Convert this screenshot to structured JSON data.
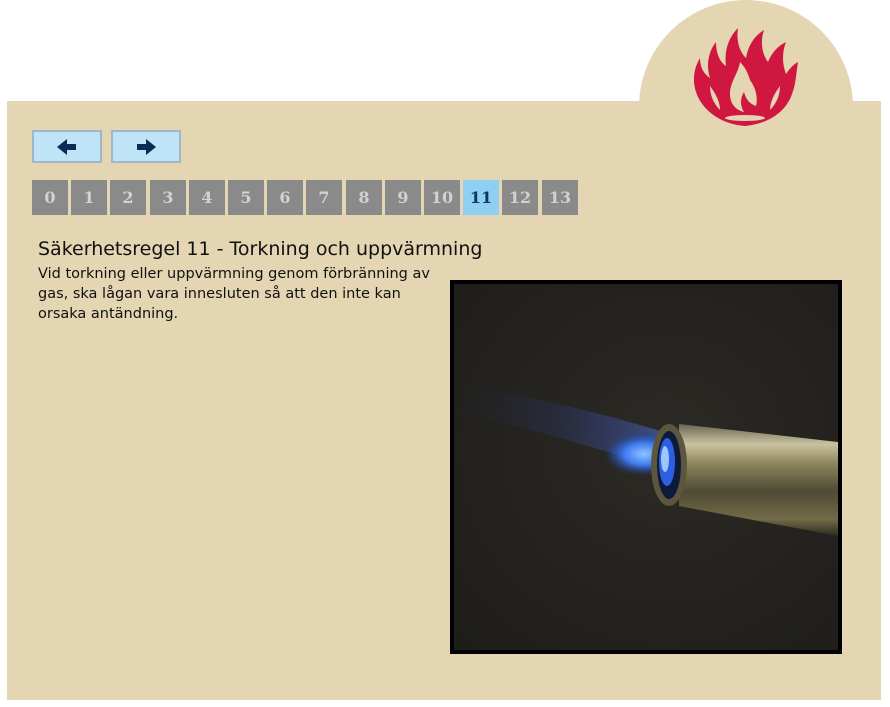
{
  "nav": {
    "prev_icon": "arrow-left-icon",
    "next_icon": "arrow-right-icon"
  },
  "logo": {
    "icon": "phoenix-flame-logo",
    "color": "#d0173f"
  },
  "pagination": {
    "pages": [
      "0",
      "1",
      "2",
      "3",
      "4",
      "5",
      "6",
      "7",
      "8",
      "9",
      "10",
      "11",
      "12",
      "13"
    ],
    "current": "11"
  },
  "content": {
    "title": "Säkerhetsregel 11 - Torkning och uppvärmning",
    "text": "Vid torkning eller uppvärmning genom förbränning av gas, ska lågan vara innesluten så att den inte kan orsaka antändning."
  },
  "image": {
    "subject": "gas-torch-blue-flame-photo"
  },
  "colors": {
    "panel": "#e4d6b2",
    "nav_button": "#bfe3f7",
    "page_inactive": "#8a8a8a",
    "page_active": "#8ecff2",
    "arrow": "#0b2a55"
  }
}
